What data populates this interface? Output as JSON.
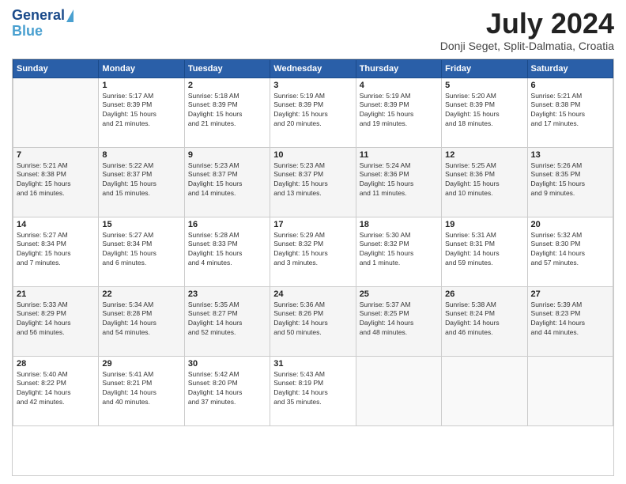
{
  "logo": {
    "line1": "General",
    "line2": "Blue"
  },
  "header": {
    "month_year": "July 2024",
    "location": "Donji Seget, Split-Dalmatia, Croatia"
  },
  "days_of_week": [
    "Sunday",
    "Monday",
    "Tuesday",
    "Wednesday",
    "Thursday",
    "Friday",
    "Saturday"
  ],
  "weeks": [
    [
      {
        "day": "",
        "info": ""
      },
      {
        "day": "1",
        "info": "Sunrise: 5:17 AM\nSunset: 8:39 PM\nDaylight: 15 hours\nand 21 minutes."
      },
      {
        "day": "2",
        "info": "Sunrise: 5:18 AM\nSunset: 8:39 PM\nDaylight: 15 hours\nand 21 minutes."
      },
      {
        "day": "3",
        "info": "Sunrise: 5:19 AM\nSunset: 8:39 PM\nDaylight: 15 hours\nand 20 minutes."
      },
      {
        "day": "4",
        "info": "Sunrise: 5:19 AM\nSunset: 8:39 PM\nDaylight: 15 hours\nand 19 minutes."
      },
      {
        "day": "5",
        "info": "Sunrise: 5:20 AM\nSunset: 8:39 PM\nDaylight: 15 hours\nand 18 minutes."
      },
      {
        "day": "6",
        "info": "Sunrise: 5:21 AM\nSunset: 8:38 PM\nDaylight: 15 hours\nand 17 minutes."
      }
    ],
    [
      {
        "day": "7",
        "info": "Sunrise: 5:21 AM\nSunset: 8:38 PM\nDaylight: 15 hours\nand 16 minutes."
      },
      {
        "day": "8",
        "info": "Sunrise: 5:22 AM\nSunset: 8:37 PM\nDaylight: 15 hours\nand 15 minutes."
      },
      {
        "day": "9",
        "info": "Sunrise: 5:23 AM\nSunset: 8:37 PM\nDaylight: 15 hours\nand 14 minutes."
      },
      {
        "day": "10",
        "info": "Sunrise: 5:23 AM\nSunset: 8:37 PM\nDaylight: 15 hours\nand 13 minutes."
      },
      {
        "day": "11",
        "info": "Sunrise: 5:24 AM\nSunset: 8:36 PM\nDaylight: 15 hours\nand 11 minutes."
      },
      {
        "day": "12",
        "info": "Sunrise: 5:25 AM\nSunset: 8:36 PM\nDaylight: 15 hours\nand 10 minutes."
      },
      {
        "day": "13",
        "info": "Sunrise: 5:26 AM\nSunset: 8:35 PM\nDaylight: 15 hours\nand 9 minutes."
      }
    ],
    [
      {
        "day": "14",
        "info": "Sunrise: 5:27 AM\nSunset: 8:34 PM\nDaylight: 15 hours\nand 7 minutes."
      },
      {
        "day": "15",
        "info": "Sunrise: 5:27 AM\nSunset: 8:34 PM\nDaylight: 15 hours\nand 6 minutes."
      },
      {
        "day": "16",
        "info": "Sunrise: 5:28 AM\nSunset: 8:33 PM\nDaylight: 15 hours\nand 4 minutes."
      },
      {
        "day": "17",
        "info": "Sunrise: 5:29 AM\nSunset: 8:32 PM\nDaylight: 15 hours\nand 3 minutes."
      },
      {
        "day": "18",
        "info": "Sunrise: 5:30 AM\nSunset: 8:32 PM\nDaylight: 15 hours\nand 1 minute."
      },
      {
        "day": "19",
        "info": "Sunrise: 5:31 AM\nSunset: 8:31 PM\nDaylight: 14 hours\nand 59 minutes."
      },
      {
        "day": "20",
        "info": "Sunrise: 5:32 AM\nSunset: 8:30 PM\nDaylight: 14 hours\nand 57 minutes."
      }
    ],
    [
      {
        "day": "21",
        "info": "Sunrise: 5:33 AM\nSunset: 8:29 PM\nDaylight: 14 hours\nand 56 minutes."
      },
      {
        "day": "22",
        "info": "Sunrise: 5:34 AM\nSunset: 8:28 PM\nDaylight: 14 hours\nand 54 minutes."
      },
      {
        "day": "23",
        "info": "Sunrise: 5:35 AM\nSunset: 8:27 PM\nDaylight: 14 hours\nand 52 minutes."
      },
      {
        "day": "24",
        "info": "Sunrise: 5:36 AM\nSunset: 8:26 PM\nDaylight: 14 hours\nand 50 minutes."
      },
      {
        "day": "25",
        "info": "Sunrise: 5:37 AM\nSunset: 8:25 PM\nDaylight: 14 hours\nand 48 minutes."
      },
      {
        "day": "26",
        "info": "Sunrise: 5:38 AM\nSunset: 8:24 PM\nDaylight: 14 hours\nand 46 minutes."
      },
      {
        "day": "27",
        "info": "Sunrise: 5:39 AM\nSunset: 8:23 PM\nDaylight: 14 hours\nand 44 minutes."
      }
    ],
    [
      {
        "day": "28",
        "info": "Sunrise: 5:40 AM\nSunset: 8:22 PM\nDaylight: 14 hours\nand 42 minutes."
      },
      {
        "day": "29",
        "info": "Sunrise: 5:41 AM\nSunset: 8:21 PM\nDaylight: 14 hours\nand 40 minutes."
      },
      {
        "day": "30",
        "info": "Sunrise: 5:42 AM\nSunset: 8:20 PM\nDaylight: 14 hours\nand 37 minutes."
      },
      {
        "day": "31",
        "info": "Sunrise: 5:43 AM\nSunset: 8:19 PM\nDaylight: 14 hours\nand 35 minutes."
      },
      {
        "day": "",
        "info": ""
      },
      {
        "day": "",
        "info": ""
      },
      {
        "day": "",
        "info": ""
      }
    ]
  ]
}
